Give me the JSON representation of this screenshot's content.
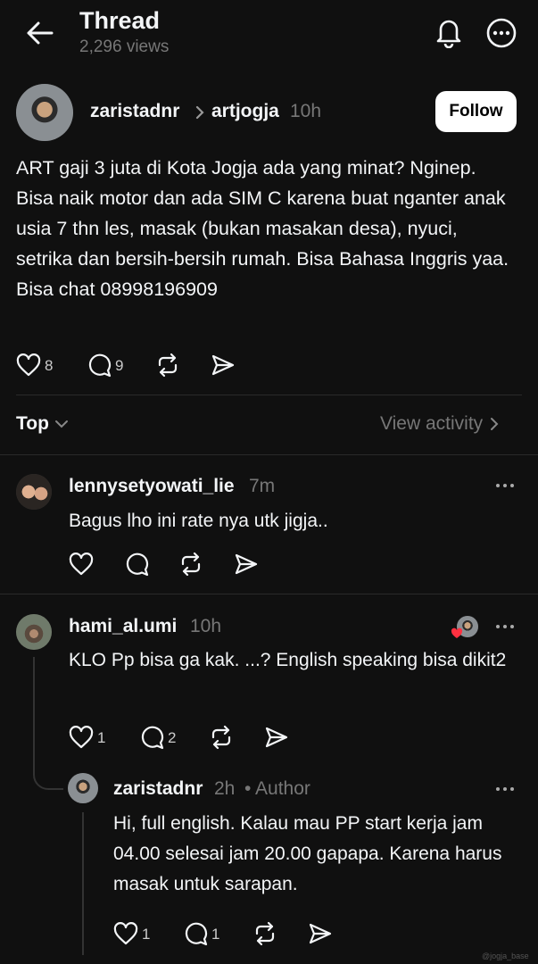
{
  "header": {
    "title": "Thread",
    "views": "2,296 views"
  },
  "post": {
    "author": "zaristadnr",
    "community": "artjogja",
    "time": "10h",
    "follow_label": "Follow",
    "text": "ART gaji 3 juta di Kota Jogja ada yang minat? Nginep. Bisa naik motor dan ada SIM C karena buat nganter anak usia 7 thn les, masak (bukan masakan desa), nyuci, setrika dan bersih-bersih rumah. Bisa Bahasa Inggris yaa. Bisa chat 08998196909",
    "likes": "8",
    "replies": "9"
  },
  "sort": {
    "label": "Top",
    "activity_label": "View activity"
  },
  "comments": [
    {
      "author": "lennysetyowati_lie",
      "time": "7m",
      "text": "Bagus lho ini rate nya utk jigja..",
      "likes": "",
      "replies": ""
    },
    {
      "author": "hami_al.umi",
      "time": "10h",
      "text": "KLO Pp bisa ga kak. ...? English speaking bisa dikit2",
      "likes": "1",
      "replies": "2"
    },
    {
      "author": "zaristadnr",
      "time": "2h",
      "tag": "• Author",
      "text": "Hi, full english. Kalau mau PP start kerja jam 04.00 selesai jam 20.00 gapapa. Karena harus masak untuk sarapan.",
      "likes": "1",
      "replies": "1"
    }
  ],
  "watermark": "@jogja_base",
  "colors": {
    "background": "#101010",
    "text": "#f3f5f7",
    "muted": "#777777",
    "follow_bg": "#ffffff",
    "heart_badge": "#ff3040"
  }
}
